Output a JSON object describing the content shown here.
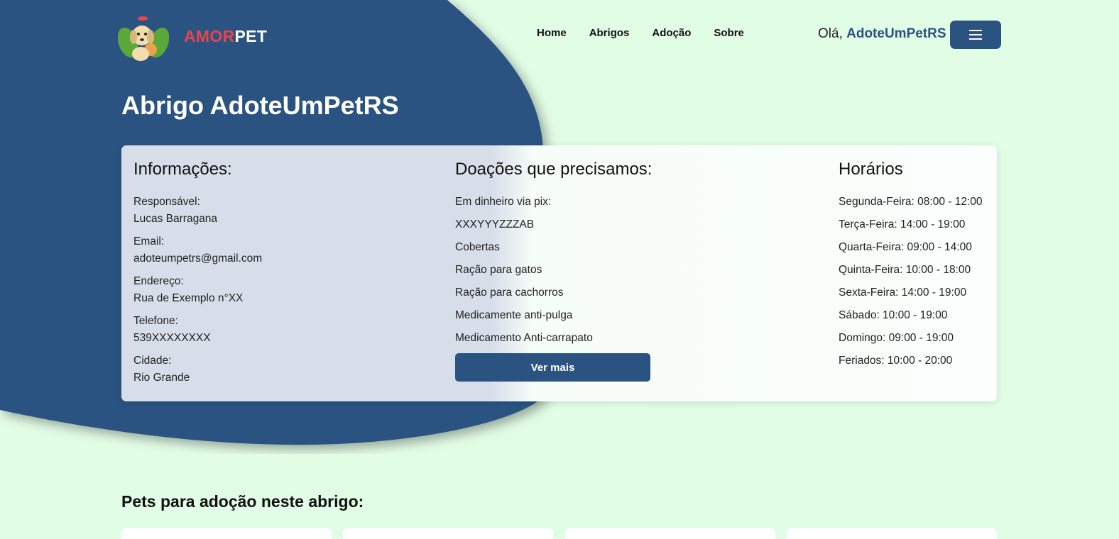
{
  "brand": {
    "part1": "AMOR",
    "part2": "PET"
  },
  "nav": [
    {
      "label": "Home"
    },
    {
      "label": "Abrigos"
    },
    {
      "label": "Adoção"
    },
    {
      "label": "Sobre"
    }
  ],
  "greeting": {
    "prefix": "Olá, ",
    "user": "AdoteUmPetRS"
  },
  "page_title": "Abrigo AdoteUmPetRS",
  "info": {
    "heading": "Informações:",
    "items": [
      {
        "label": "Responsável:",
        "value": "Lucas Barragana"
      },
      {
        "label": "Email:",
        "value": "adoteumpetrs@gmail.com"
      },
      {
        "label": "Endereço:",
        "value": "Rua de Exemplo n°XX"
      },
      {
        "label": "Telefone:",
        "value": "539XXXXXXXX"
      },
      {
        "label": "Cidade:",
        "value": "Rio Grande"
      }
    ]
  },
  "donations": {
    "heading": "Doações que precisamos:",
    "items": [
      "Em dinheiro via pix:",
      "XXXYYYZZZAB",
      "Cobertas",
      "Ração para gatos",
      "Ração para cachorros",
      "Medicamente anti-pulga",
      "Medicamento Anti-carrapato"
    ],
    "button_label": "Ver mais"
  },
  "hours": {
    "heading": "Horários",
    "items": [
      "Segunda-Feira: 08:00 - 12:00",
      "Terça-Feira: 14:00 - 19:00",
      "Quarta-Feira: 09:00 - 14:00",
      "Quinta-Feira: 10:00 - 18:00",
      "Sexta-Feira: 14:00 - 19:00",
      "Sábado: 10:00 - 19:00",
      "Domingo: 09:00 - 19:00",
      "Feriados: 10:00 - 20:00"
    ]
  },
  "pets_section": {
    "title": "Pets para adoção neste abrigo:"
  },
  "colors": {
    "background": "#e2fde6",
    "primary": "#2b5382",
    "brand_red": "#e8444a"
  }
}
